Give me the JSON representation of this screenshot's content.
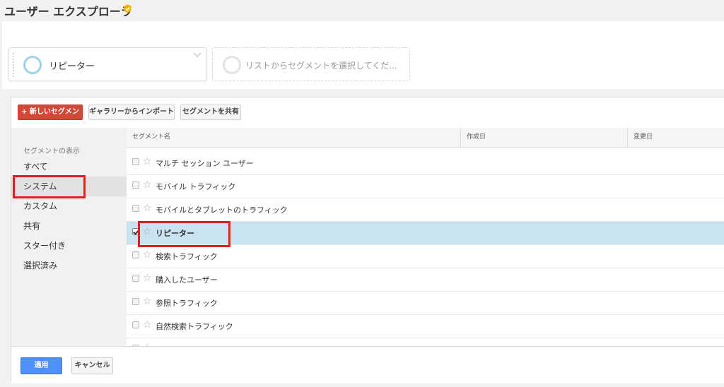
{
  "header": {
    "title": "ユーザー エクスプローラ",
    "verified_icon": "verified-shield-icon",
    "accent_color": "#f0b400"
  },
  "segment_bar": {
    "active_segment": {
      "label": "リピーター",
      "ring_color": "#9dd0ea"
    },
    "empty_slot": {
      "placeholder": "リストからセグメントを選択してくだ..."
    }
  },
  "toolbar": {
    "new_segment_label": "+ 新しいセグメント",
    "import_label": "ギャラリーからインポート",
    "share_label": "セグメントを共有"
  },
  "sidebar": {
    "heading": "セグメントの表示",
    "items": [
      {
        "label": "すべて",
        "selected": false
      },
      {
        "label": "システム",
        "selected": true
      },
      {
        "label": "カスタム",
        "selected": false
      },
      {
        "label": "共有",
        "selected": false
      },
      {
        "label": "スター付き",
        "selected": false
      },
      {
        "label": "選択済み",
        "selected": false
      }
    ]
  },
  "table": {
    "columns": [
      "セグメント名",
      "作成日",
      "変更日"
    ],
    "rows": [
      {
        "name": "マルチ セッション ユーザー",
        "checked": false
      },
      {
        "name": "モバイル トラフィック",
        "checked": false
      },
      {
        "name": "モバイルとタブレットのトラフィック",
        "checked": false
      },
      {
        "name": "リピーター",
        "checked": true
      },
      {
        "name": "検索トラフィック",
        "checked": false
      },
      {
        "name": "購入したユーザー",
        "checked": false
      },
      {
        "name": "参照トラフィック",
        "checked": false
      },
      {
        "name": "自然検索トラフィック",
        "checked": false
      }
    ]
  },
  "footer": {
    "apply_label": "適用",
    "cancel_label": "キャンセル"
  }
}
